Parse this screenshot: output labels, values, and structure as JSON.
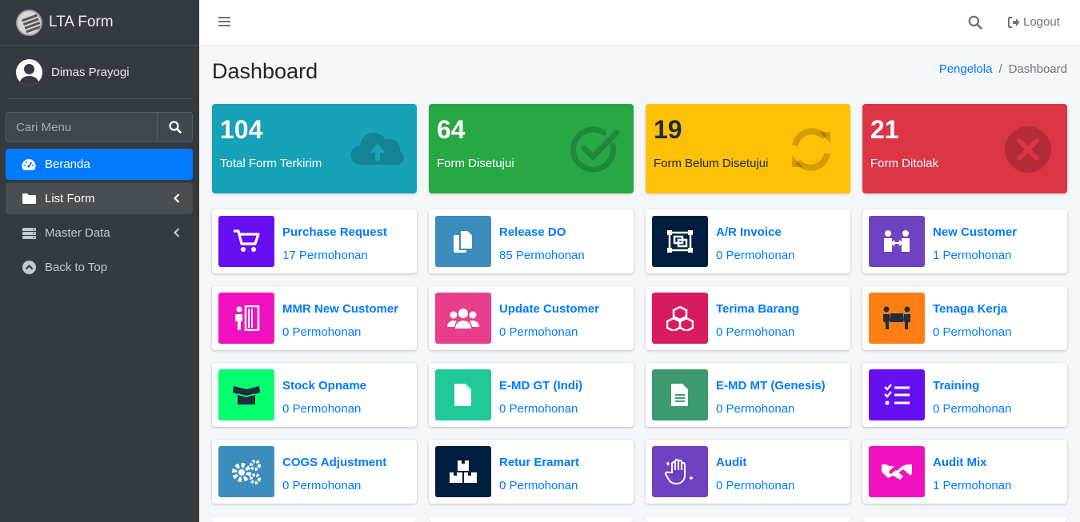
{
  "app": {
    "title": "LTA Form"
  },
  "user": {
    "name": "Dimas Prayogi"
  },
  "sidebar": {
    "search_placeholder": "Cari Menu",
    "items": [
      {
        "label": "Beranda",
        "icon": "tachometer-icon",
        "state": "active"
      },
      {
        "label": "List Form",
        "icon": "folder-icon",
        "state": "open"
      },
      {
        "label": "Master Data",
        "icon": "server-icon",
        "state": "normal"
      },
      {
        "label": "Back to Top",
        "icon": "chevron-circle-up-icon",
        "state": "normal"
      }
    ]
  },
  "topbar": {
    "logout_label": "Logout"
  },
  "header": {
    "title": "Dashboard",
    "breadcrumb": [
      "Pengelola",
      "Dashboard"
    ]
  },
  "stats": [
    {
      "value": "104",
      "label": "Total Form Terkirim",
      "color": "#17a2b8",
      "icon": "cloud-upload-icon"
    },
    {
      "value": "64",
      "label": "Form Disetujui",
      "color": "#28a745",
      "icon": "check-circle-icon"
    },
    {
      "value": "19",
      "label": "Form Belum Disetujui",
      "color": "#ffc107",
      "icon": "sync-icon"
    },
    {
      "value": "21",
      "label": "Form Ditolak",
      "color": "#dc3545",
      "icon": "times-circle-icon"
    }
  ],
  "forms": [
    {
      "title": "Purchase Request",
      "count": "17 Permohonan",
      "color": "#6610f2",
      "icon": "cart-icon"
    },
    {
      "title": "Release DO",
      "count": "85 Permohonan",
      "color": "#3c8dbc",
      "icon": "copy-icon"
    },
    {
      "title": "A/R Invoice",
      "count": "0 Permohonan",
      "color": "#001f3f",
      "icon": "object-group-icon"
    },
    {
      "title": "New Customer",
      "count": "1 Permohonan",
      "color": "#6f42c1",
      "icon": "people-arrows-icon"
    },
    {
      "title": "MMR New Customer",
      "count": "0 Permohonan",
      "color": "#f012be",
      "icon": "person-booth-icon"
    },
    {
      "title": "Update Customer",
      "count": "0 Permohonan",
      "color": "#e83e8c",
      "icon": "users-icon"
    },
    {
      "title": "Terima Barang",
      "count": "0 Permohonan",
      "color": "#d81b60",
      "icon": "cubes-icon"
    },
    {
      "title": "Tenaga Kerja",
      "count": "0 Permohonan",
      "color": "#fd7e14",
      "icon": "people-carry-icon"
    },
    {
      "title": "Stock Opname",
      "count": "0 Permohonan",
      "color": "#01ff70",
      "icon": "box-open-icon"
    },
    {
      "title": "E-MD GT (Indi)",
      "count": "0 Permohonan",
      "color": "#20c997",
      "icon": "file-icon"
    },
    {
      "title": "E-MD MT (Genesis)",
      "count": "0 Permohonan",
      "color": "#3d9970",
      "icon": "file-alt-icon"
    },
    {
      "title": "Training",
      "count": "0 Permohonan",
      "color": "#6610f2",
      "icon": "tasks-icon"
    },
    {
      "title": "COGS Adjustment",
      "count": "0 Permohonan",
      "color": "#3c8dbc",
      "icon": "cogs-icon"
    },
    {
      "title": "Retur Eramart",
      "count": "0 Permohonan",
      "color": "#001f3f",
      "icon": "boxes-icon"
    },
    {
      "title": "Audit",
      "count": "0 Permohonan",
      "color": "#6f42c1",
      "icon": "hand-sparkles-icon"
    },
    {
      "title": "Audit Mix",
      "count": "1 Permohonan",
      "color": "#f012be",
      "icon": "handshake-icon"
    }
  ]
}
